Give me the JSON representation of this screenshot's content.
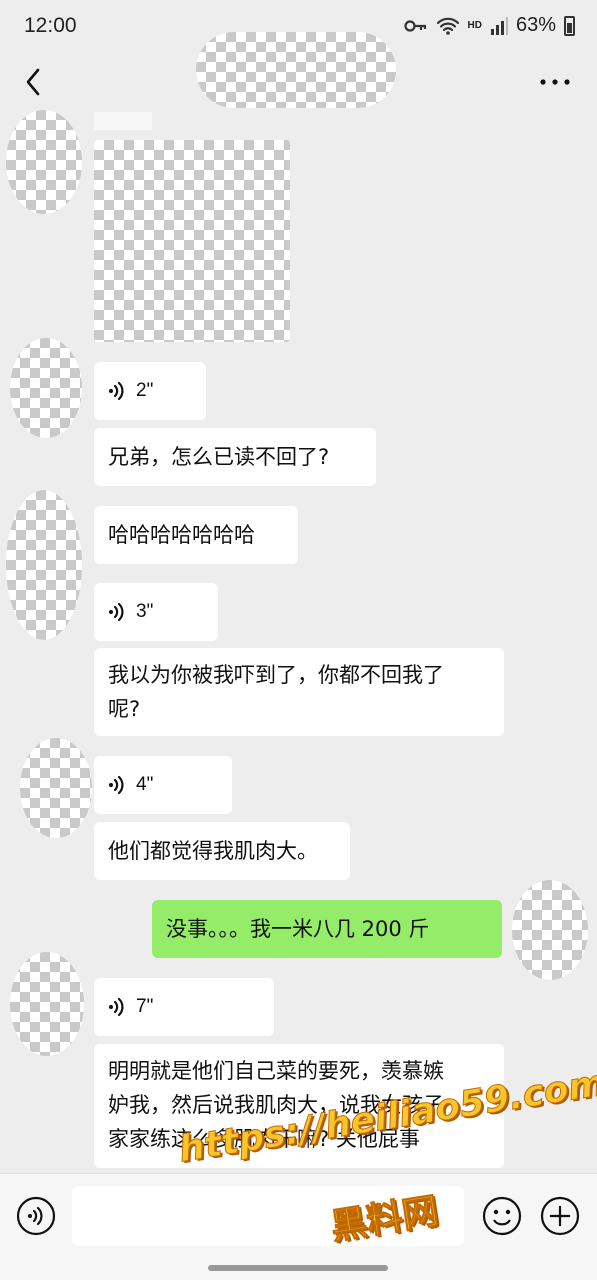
{
  "status_bar": {
    "time": "12:00",
    "network": "HD",
    "battery": "63%"
  },
  "chat": {
    "voice_messages": [
      "2\"",
      "3\"",
      "4\"",
      "7\""
    ],
    "texts": {
      "m1": "兄弟，怎么已读不回了?",
      "m2": "哈哈哈哈哈哈哈",
      "m3_line1": "我以为你被我吓到了，你都不回我了",
      "m3_line2": "呢?",
      "m4": "他们都觉得我肌肉大。",
      "m5_sent": "没事。。。我一米八几 200 斤",
      "m6_line1": "明明就是他们自己菜的要死，羡慕嫉",
      "m6_line2": "妒我，然后说我肌肉大，说我女孩子",
      "m6_line3": "家家练这么多肌肉干嘛? 关他屁事"
    }
  },
  "watermark": {
    "line1": "https://heiliao59.com",
    "line2": "黑料网"
  },
  "colors": {
    "background": "#ededed",
    "sent_bubble": "#95ec69",
    "received_bubble": "#ffffff"
  },
  "icons": [
    "back-arrow-icon",
    "more-dots-icon",
    "voice-wave-icon",
    "emoji-icon",
    "plus-icon",
    "wifi-icon",
    "signal-icon",
    "key-icon"
  ]
}
